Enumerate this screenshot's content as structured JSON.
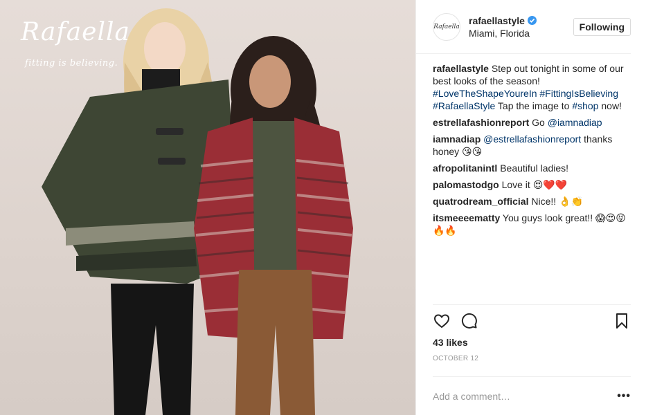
{
  "photo": {
    "brand_logo": "Rafaella",
    "brand_tagline": "fitting is believing."
  },
  "header": {
    "avatar_text": "Rafaella",
    "username": "rafaellastyle",
    "location": "Miami, Florida",
    "follow_label": "Following"
  },
  "caption": {
    "author": "rafaellastyle",
    "text1": "Step out tonight in some of our best looks of the season!",
    "tag1": "#LoveTheShapeYoureIn",
    "tag2": "#FittingIsBelieving",
    "tag3": "#RafaellaStyle",
    "text2": "Tap the image to",
    "tag4": "#shop",
    "text3": "now!"
  },
  "comments": [
    {
      "author": "estrellafashionreport",
      "pre": "Go",
      "mention": "@iamnadiap",
      "text": ""
    },
    {
      "author": "iamnadiap",
      "pre": "",
      "mention": "@estrellafashionreport",
      "text": "thanks honey 😘😘"
    },
    {
      "author": "afropolitanintl",
      "pre": "",
      "mention": "",
      "text": "Beautiful ladies!"
    },
    {
      "author": "palomastodgo",
      "pre": "",
      "mention": "",
      "text": "Love it 😍❤️❤️"
    },
    {
      "author": "quatrodream_official",
      "pre": "",
      "mention": "",
      "text": "Nice!! 👌👏"
    },
    {
      "author": "itsmeeeematty",
      "pre": "",
      "mention": "",
      "text": "You guys look great!! 😱😍😝🔥🔥"
    }
  ],
  "actions": {
    "icons": [
      "heart-icon",
      "comment-icon",
      "bookmark-icon"
    ],
    "likes": "43 likes",
    "date": "OCTOBER 12"
  },
  "comment_box": {
    "placeholder": "Add a comment…",
    "more_label": "•••"
  },
  "colors": {
    "link": "#003569",
    "verified": "#3897f0",
    "muted": "#999999"
  }
}
